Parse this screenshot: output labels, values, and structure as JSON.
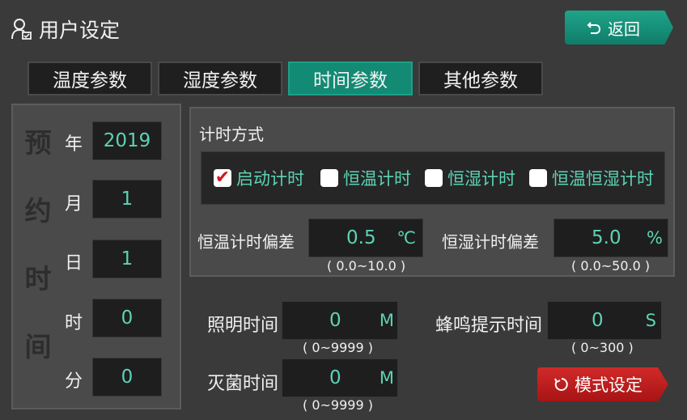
{
  "header": {
    "title": "用户设定",
    "back_label": "返回"
  },
  "tabs": [
    {
      "label": "温度参数",
      "active": false
    },
    {
      "label": "湿度参数",
      "active": false
    },
    {
      "label": "时间参数",
      "active": true
    },
    {
      "label": "其他参数",
      "active": false
    }
  ],
  "schedule": {
    "vertical_title": [
      "预",
      "约",
      "时",
      "间"
    ],
    "fields": [
      {
        "label": "年",
        "value": "2019"
      },
      {
        "label": "月",
        "value": "1"
      },
      {
        "label": "日",
        "value": "1"
      },
      {
        "label": "时",
        "value": "0"
      },
      {
        "label": "分",
        "value": "0"
      }
    ]
  },
  "timing": {
    "section_label": "计时方式",
    "options": [
      {
        "label": "启动计时",
        "checked": true
      },
      {
        "label": "恒温计时",
        "checked": false
      },
      {
        "label": "恒湿计时",
        "checked": false
      },
      {
        "label": "恒温恒湿计时",
        "checked": false
      }
    ],
    "temp_deviation": {
      "label": "恒温计时偏差",
      "value": "0.5",
      "unit": "℃",
      "range": "( 0.0~10.0 )"
    },
    "humidity_deviation": {
      "label": "恒湿计时偏差",
      "value": "5.0",
      "unit": "%",
      "range": "( 0.0~50.0 )"
    }
  },
  "lighting": {
    "label": "照明时间",
    "value": "0",
    "unit": "M",
    "range": "( 0~9999 )"
  },
  "buzzer": {
    "label": "蜂鸣提示时间",
    "value": "0",
    "unit": "S",
    "range": "( 0~300 )"
  },
  "sterilize": {
    "label": "灭菌时间",
    "value": "0",
    "unit": "M",
    "range": "( 0~9999 )"
  },
  "mode_button_label": "模式设定",
  "colors": {
    "accent": "#128a74",
    "value_text": "#5dd3b5",
    "danger": "#c21f1f",
    "background": "#3a3a3a"
  }
}
